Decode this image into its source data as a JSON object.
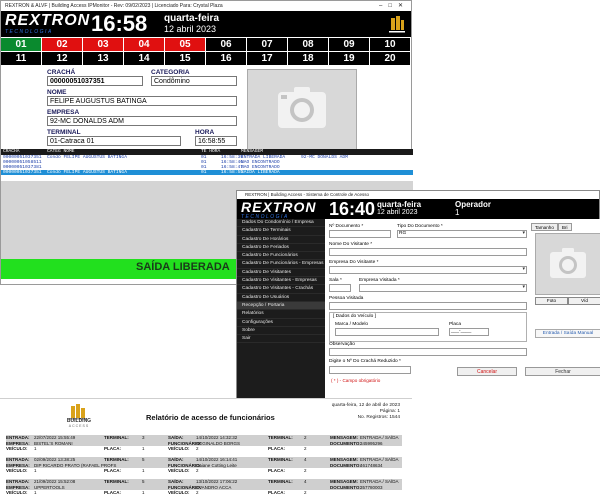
{
  "monitor": {
    "title_bar": "REXTRON & ALVF | Building Access IPMonitor - Rev: 09/02/2023 | Licenciado Para: Crystal Plaza",
    "logo_text": "REXTRON",
    "logo_sub": "TECNOLOGIA",
    "clock": "16:58",
    "weekday": "quarta-feira",
    "date": "12 abril 2023",
    "gates_row1": [
      {
        "n": "01",
        "state": "green"
      },
      {
        "n": "02",
        "state": "red"
      },
      {
        "n": "03",
        "state": "red"
      },
      {
        "n": "04",
        "state": "red"
      },
      {
        "n": "05",
        "state": "red"
      },
      {
        "n": "06",
        "state": "black"
      },
      {
        "n": "07",
        "state": "black"
      },
      {
        "n": "08",
        "state": "black"
      },
      {
        "n": "09",
        "state": "black"
      },
      {
        "n": "10",
        "state": "black"
      }
    ],
    "gates_row2": [
      "11",
      "12",
      "13",
      "14",
      "15",
      "16",
      "17",
      "18",
      "19",
      "20"
    ],
    "colors": {
      "green": "#0a8a2e",
      "red": "#e01010",
      "saida_bg": "#22e01e",
      "selected_row": "#1f8fd6"
    },
    "labels": {
      "cracha": "CRACHÁ",
      "categoria": "CATEGORIA",
      "nome": "NOME",
      "empresa": "EMPRESA",
      "terminal": "TERMINAL",
      "hora": "HORA"
    },
    "values": {
      "cracha": "00000051037351",
      "categoria": "Condômino",
      "nome": "FELIPE AUGUSTUS BATINGA",
      "empresa": "92-MC DONALDS ADM",
      "terminal": "01-Catraca 01",
      "hora": "16:58:55"
    },
    "log_headers": [
      "CRACHÁ",
      "CATEG NOME",
      "TE HORA",
      "MENSAGEM"
    ],
    "log_rows": [
      {
        "id": "00000051037351",
        "nome": "Condô FELIPE AUGUSTUS BATINGA",
        "te": "01",
        "hora": "16:58:39",
        "msg": "ENTRADA LIBERADA",
        "extra": "92-MC DONALDS ADM",
        "sel": false
      },
      {
        "id": "00000051058511",
        "nome": "",
        "te": "01",
        "hora": "16:58:46",
        "msg": "NAO ENCONTRADO",
        "extra": "",
        "sel": false
      },
      {
        "id": "00000051037381",
        "nome": "",
        "te": "01",
        "hora": "16:58:47",
        "msg": "NAO ENCONTRADO",
        "extra": "",
        "sel": false
      },
      {
        "id": "00000051037351",
        "nome": "Condô FELIPE AUGUSTUS BATINGA",
        "te": "01",
        "hora": "16:58:55",
        "msg": "SAÍDA LIBERADA",
        "extra": "",
        "sel": true
      }
    ],
    "status_message": "SAÍDA LIBERADA"
  },
  "registration": {
    "title_bar": "REXTRON | Building Access - Sistema de Controle de Acesso",
    "logo_text": "REXTRON",
    "logo_sub": "TECNOLOGIA",
    "clock": "16:40",
    "weekday": "quarta-feira",
    "date": "12 abril 2023",
    "operator_label": "Operador",
    "operator_value": "1",
    "menu": [
      "Dados Do Condomínio / Empresa",
      "Cadastro De Terminais",
      "Cadastro De Horários",
      "Cadastro De Feriados",
      "Cadastro De Funcionários",
      "Cadastro De Funcionários - Empresas",
      "Cadastro De Visitantes",
      "Cadastro De Visitantes - Empresas",
      "Cadastro De Visitantes - Crachás",
      "Cadastro De Usuários",
      "Recepção / Portaria",
      "Relatórios",
      "Configurações",
      "Sobre",
      "Sair"
    ],
    "active_menu_index": 10,
    "form": {
      "n_documento": "Nº Documento",
      "tipo_documento": "Tipo Do Documento",
      "tipo_documento_value": "RG",
      "nome_visitante": "Nome Do Visitante",
      "empresa_visitante": "Empresa Do Visitante",
      "sala": "Sala",
      "empresa_visitada": "Empresa Visitada",
      "pessoa_visitada": "Pessoa Visitada",
      "dados_veiculo": "[ Dados do Veículo ]",
      "marca_modelo": "Marca / Modelo",
      "placa": "Placa",
      "placa_value": "___-____",
      "observacao": "Observação",
      "cracha_reduzido": "Digite o Nº Do Crachá Reduzido",
      "required_note": "( * ) - Campo obrigatório",
      "cancelar": "Cancelar",
      "fechar": "Fechar",
      "tab_tamanho": "Tamanho",
      "tab_bri": "Bri",
      "foto": "Foto",
      "video": "Víd",
      "entrada_saida_manual": "Entrada / Saída Manual"
    }
  },
  "report": {
    "title": "Relatório de acesso de funcionários",
    "logo_text": "BUILDING",
    "logo_sub": "ACCESS",
    "meta_date": "quarta-feira, 12 de abril de 2023",
    "meta_page": "Página: 1",
    "meta_regs": "No. Registros: 1544",
    "records": [
      {
        "entrada_lbl": "ENTRADA:",
        "entrada": "22/07/2022 15:55:49",
        "term_lbl": "TERMINAL:",
        "term": "3",
        "saida_lbl": "SAÍDA:",
        "saida": "14/10/2022 14:32:32",
        "term2_lbl": "TERMINAL:",
        "term2": "2",
        "msg_lbl": "MENSAGEM:",
        "msg": "ENTRADA / SAÍDA",
        "empresa_lbl": "EMPRESA:",
        "empresa": "BISTEL'S ROMANI",
        "func_lbl": "FUNCIONÁRIO:",
        "func": "REGINALDO BORGS",
        "doc_lbl": "DOCUMENTO:",
        "doc": "345995296",
        "veiculo_lbl": "VEÍCULO:",
        "veiculo": "1",
        "placa_lbl": "PLACA:",
        "placa": "1",
        "veiculo2_lbl": "VEÍCULO:",
        "veiculo2": "2",
        "placa2_lbl": "PLACA:",
        "placa2": "2"
      },
      {
        "entrada_lbl": "ENTRADA:",
        "entrada": "02/09/2022 13:38:25",
        "term_lbl": "TERMINAL:",
        "term": "5",
        "saida_lbl": "SAÍDA:",
        "saida": "14/10/2022 16:14:41",
        "term2_lbl": "TERMINAL:",
        "term2": "4",
        "msg_lbl": "MENSAGEM:",
        "msg": "ENTRADA / SAÍDA",
        "empresa_lbl": "EMPRESA:",
        "empresa": "DIP RICARDO PRATO (RAFAEL PROFS",
        "func_lbl": "FUNCIONÁRIO:",
        "func": "Daiane Cotting Leite",
        "doc_lbl": "DOCUMENTO:",
        "doc": "461748634",
        "veiculo_lbl": "VEÍCULO:",
        "veiculo": "1",
        "placa_lbl": "PLACA:",
        "placa": "1",
        "veiculo2_lbl": "VEÍCULO:",
        "veiculo2": "2",
        "placa2_lbl": "PLACA:",
        "placa2": "2"
      },
      {
        "entrada_lbl": "ENTRADA:",
        "entrada": "21/09/2022 15:52:08",
        "term_lbl": "TERMINAL:",
        "term": "5",
        "saida_lbl": "SAÍDA:",
        "saida": "13/10/2022 17:06:22",
        "term2_lbl": "TERMINAL:",
        "term2": "4",
        "msg_lbl": "MENSAGEM:",
        "msg": "ENTRADA / SAÍDA",
        "empresa_lbl": "EMPRESA:",
        "empresa": "UPPERTOOLS",
        "func_lbl": "FUNCIONÁRIO:",
        "func": "EVANDRO ACCA",
        "doc_lbl": "DOCUMENTO:",
        "doc": "357780003",
        "veiculo_lbl": "VEÍCULO:",
        "veiculo": "1",
        "placa_lbl": "PLACA:",
        "placa": "1",
        "veiculo2_lbl": "VEÍCULO:",
        "veiculo2": "2",
        "placa2_lbl": "PLACA:",
        "placa2": "2"
      }
    ]
  }
}
